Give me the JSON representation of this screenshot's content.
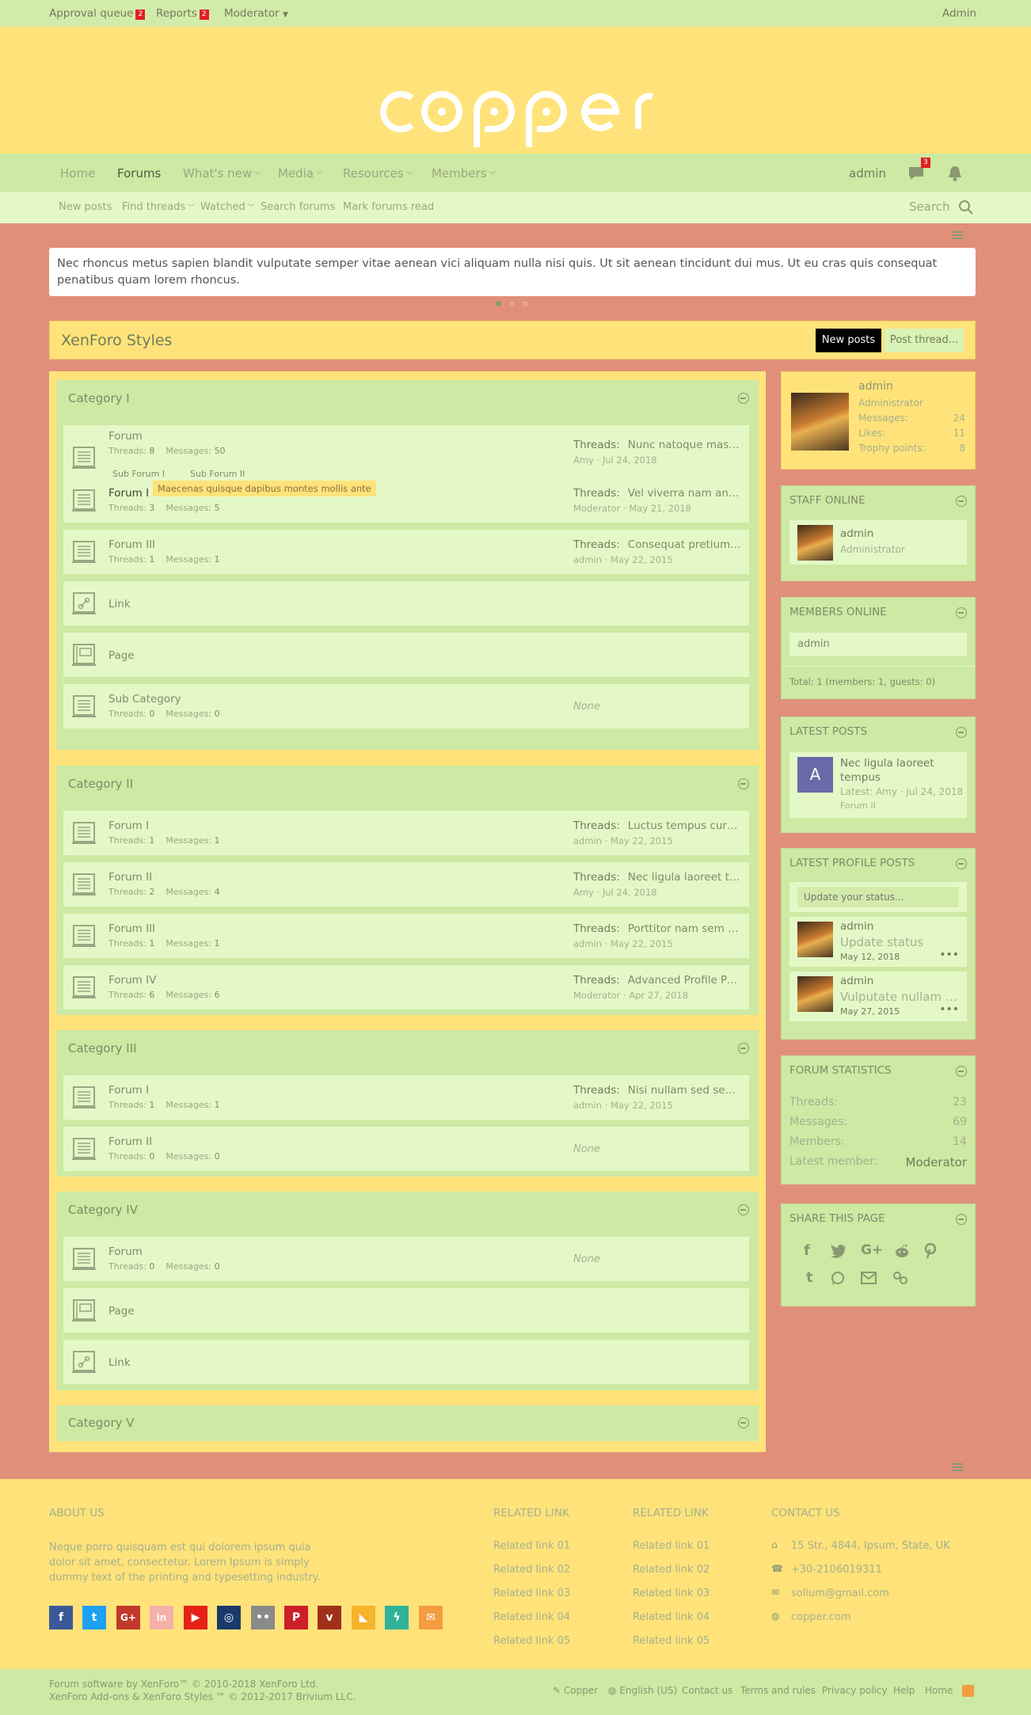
{
  "topbar": {
    "approval_label": "Approval queue",
    "approval_count": "2",
    "reports_label": "Reports",
    "reports_count": "2",
    "moderator_label": "Moderator",
    "admin_label": "Admin"
  },
  "header": {
    "logo_text": "copper"
  },
  "nav": {
    "home": "Home",
    "forums": "Forums",
    "whats_new": "What's new",
    "media": "Media",
    "resources": "Resources",
    "members": "Members",
    "user": "admin",
    "conversations_count": "3"
  },
  "subnav": {
    "new_posts": "New posts",
    "find_threads": "Find threads",
    "watched": "Watched",
    "search_forums": "Search forums",
    "mark_read": "Mark forums read",
    "search": "Search"
  },
  "notice": {
    "text": "Nec rhoncus metus sapien blandit vulputate semper vitae aenean vici aliquam nulla nisi quis. Ut sit aenean tincidunt dui mus. Ut eu cras quis consequat penatibus quam lorem rhoncus."
  },
  "page": {
    "title": "XenForo Styles",
    "new_posts_btn": "New posts",
    "post_thread_btn": "Post thread..."
  },
  "labels": {
    "threads": "Threads:",
    "messages": "Messages:",
    "none": "None"
  },
  "categories": [
    {
      "title": "Category I",
      "nodes": [
        {
          "name": "Forum",
          "threads": "8",
          "messages": "50",
          "last_title": "Nunc natoque massa ac ipsum",
          "last_meta": "Amy · Jul 24, 2018",
          "subs": [
            "Sub Forum I",
            "Sub Forum II"
          ]
        },
        {
          "name": "Forum I",
          "threads": "3",
          "messages": "5",
          "last_title": "Vel viverra nam ante sem",
          "last_meta": "Moderator · May 21, 2018",
          "tooltip": "Maecenas quisque dapibus montes mollis ante"
        },
        {
          "name": "Forum III",
          "threads": "1",
          "messages": "1",
          "last_title": "Consequat pretium sed nec",
          "last_meta": "admin · May 22, 2015"
        },
        {
          "name": "Link"
        },
        {
          "name": "Page"
        },
        {
          "name": "Sub Category",
          "threads": "0",
          "messages": "0"
        }
      ]
    },
    {
      "title": "Category II",
      "nodes": [
        {
          "name": "Forum I",
          "threads": "1",
          "messages": "1",
          "last_title": "Luctus tempus curabitur ut",
          "last_meta": "admin · May 22, 2015"
        },
        {
          "name": "Forum II",
          "threads": "2",
          "messages": "4",
          "last_title": "Nec ligula laoreet tempus",
          "last_meta": "Amy · Jul 24, 2018"
        },
        {
          "name": "Forum III",
          "threads": "1",
          "messages": "1",
          "last_title": "Porttitor nam sem nunc",
          "last_meta": "admin · May 22, 2015"
        },
        {
          "name": "Forum IV",
          "threads": "6",
          "messages": "6",
          "last_title": "Advanced Profile Post",
          "last_meta": "Moderator · Apr 27, 2018"
        }
      ]
    },
    {
      "title": "Category III",
      "nodes": [
        {
          "name": "Forum I",
          "threads": "1",
          "messages": "1",
          "last_title": "Nisi nullam sed sem tellus",
          "last_meta": "admin · May 22, 2015"
        },
        {
          "name": "Forum II",
          "threads": "0",
          "messages": "0"
        }
      ]
    },
    {
      "title": "Category IV",
      "nodes": [
        {
          "name": "Forum",
          "threads": "0",
          "messages": "0"
        },
        {
          "name": "Page"
        },
        {
          "name": "Link"
        }
      ]
    },
    {
      "title": "Category V"
    }
  ],
  "sidebar": {
    "profile": {
      "name": "admin",
      "role": "Administrator",
      "messages_label": "Messages:",
      "messages": "24",
      "likes_label": "Likes:",
      "likes": "11",
      "trophy_label": "Trophy points:",
      "trophy": "8"
    },
    "staff": {
      "title": "STAFF ONLINE",
      "name": "admin",
      "role": "Administrator"
    },
    "members": {
      "title": "MEMBERS ONLINE",
      "name": "admin",
      "total": "Total: 1 (members: 1, guests: 0)"
    },
    "latest_posts": {
      "title": "LATEST POSTS",
      "avatar_letter": "A",
      "post_title": "Nec ligula laoreet tempus",
      "meta": "Latest: Amy · Jul 24, 2018",
      "forum": "Forum II"
    },
    "profile_posts": {
      "title": "LATEST PROFILE POSTS",
      "placeholder": "Update your status...",
      "p1_name": "admin",
      "p1_text": "Update status",
      "p1_date": "May 12, 2018",
      "p2_name": "admin",
      "p2_text": "Vulputate nullam cras",
      "p2_date": "May 27, 2015"
    },
    "stats": {
      "title": "FORUM STATISTICS",
      "threads_label": "Threads:",
      "threads": "23",
      "messages_label": "Messages:",
      "messages": "69",
      "members_label": "Members:",
      "members": "14",
      "latest_label": "Latest member:",
      "latest": "Moderator"
    },
    "share": {
      "title": "SHARE THIS PAGE"
    }
  },
  "footer": {
    "about_title": "ABOUT US",
    "about_text": "Neque porro quisquam est qui dolorem ipsum quia dolor sit amet, consectetur. Lorem Ipsum is simply dummy text of the printing and typesetting industry.",
    "related1_title": "RELATED LINK",
    "related2_title": "RELATED LINK",
    "links": [
      "Related link 01",
      "Related link 02",
      "Related link 03",
      "Related link 04",
      "Related link 05"
    ],
    "contact_title": "CONTACT US",
    "address": "15 Str., 4844, Ipsum, State, UK",
    "phone": "+30-2106019311",
    "email": "solium@gmail.com",
    "site": "copper.com"
  },
  "bottombar": {
    "line1": "Forum software by XenForo™ © 2010-2018 XenForo Ltd.",
    "line2": "XenForo Add-ons & XenForo Styles ™ © 2012-2017 Brivium LLC.",
    "style": "Copper",
    "lang": "English (US)",
    "contact": "Contact us",
    "terms": "Terms and rules",
    "privacy": "Privacy policy",
    "help": "Help",
    "home": "Home"
  },
  "colors": {
    "bg": "#e0907a",
    "yellow": "#ffe37a",
    "green": "#cde9a3",
    "light_green": "#e4f8c7",
    "badge": "#e02020"
  }
}
